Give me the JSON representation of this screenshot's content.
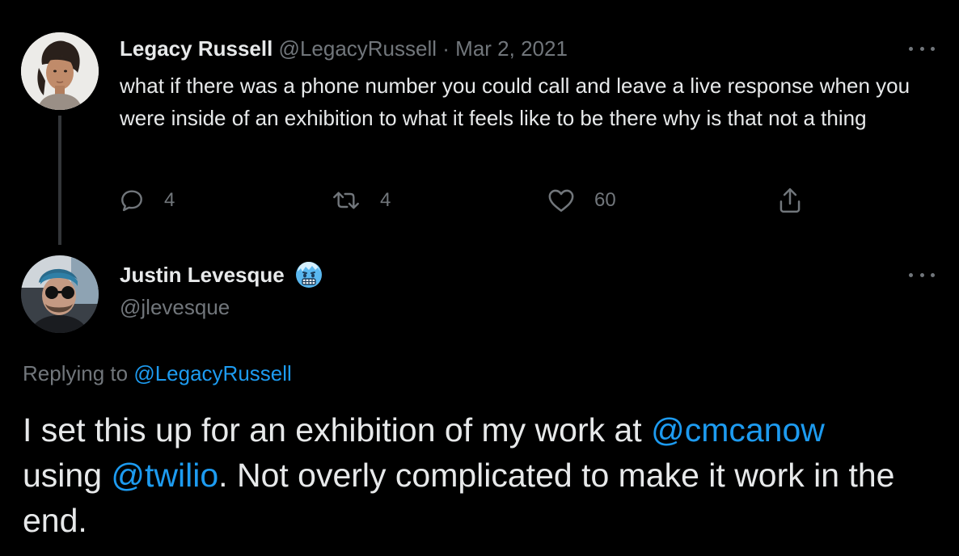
{
  "parent_tweet": {
    "author_name": "Legacy Russell",
    "handle": "@LegacyRussell",
    "separator": "·",
    "date": "Mar 2, 2021",
    "text": "what if there was a phone number you could call and leave a live response when you were inside of an exhibition to what it feels like to be there why is that not a thing",
    "replies": "4",
    "retweets": "4",
    "likes": "60",
    "icons": [
      "reply-icon",
      "retweet-icon",
      "like-icon",
      "share-icon",
      "more-icon"
    ]
  },
  "reply_tweet": {
    "author_name": "Justin Levesque",
    "author_emoji": "cold-face-emoji",
    "handle": "@jlevesque",
    "replying_prefix": "Replying to",
    "replying_to": "@LegacyRussell",
    "text_part1": "I set this up for an exhibition of my work at ",
    "mention1": "@cmcanow",
    "text_part2": "using ",
    "mention2": "@twilio",
    "text_part3": ". Not overly complicated to make it work in the end."
  },
  "colors": {
    "background": "#000000",
    "text": "#e7e9ea",
    "muted": "#71767b",
    "link": "#1d9bf0",
    "thread_line": "#333639"
  }
}
